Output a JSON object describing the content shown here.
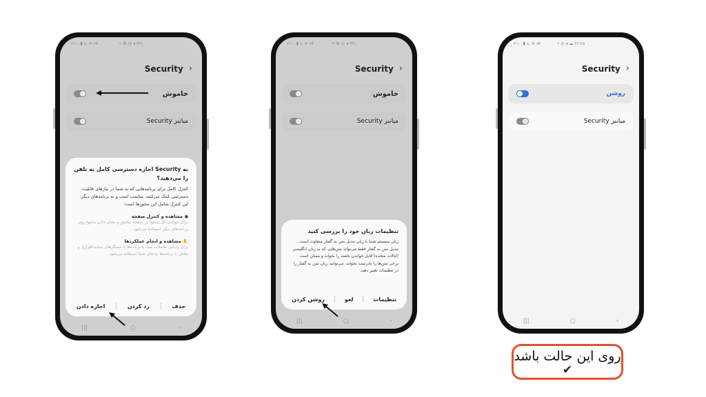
{
  "phones": [
    {
      "header_title": "Security",
      "status_left": "۲۱:۰ ▮ ⊾ ≋ ⋊",
      "status_right": "• ⌘ ◎ ◂ ٩٩٪",
      "rows": [
        {
          "label": "خاموش",
          "toggle": "off"
        },
        {
          "label": "میانبر Security",
          "toggle": "off"
        }
      ],
      "dialog": {
        "title": "به Security اجازه دسترسی کامل به تلفن را می‌دهید؟",
        "body": "کنترل کامل برای برنامه‌هایی که به شما در نیازهای قابلیت دسترسی کمک می‌کنند، مناسب است و نه برنامه‌های دیگر. این کنترل شامل این مجوزها است:",
        "perm1_title": "مشاهده و کنترل صفحه",
        "perm1_desc": "برای خواندن کل محتوا در صفحه نمایش و نشان دادن محتوا روی برنامه‌های دیگر استفاده می‌شود",
        "perm2_title": "مشاهده و انجام عملکردها",
        "perm2_desc": "برای ردیابی تعاملات شما با برنامه‌ها یا حسگرهای سخت‌افزاری و تعامل با برنامه‌ها به جای شما استفاده می‌شود",
        "actions": [
          "حذف",
          "رد کردن",
          "اجازه دادن"
        ]
      }
    },
    {
      "header_title": "Security",
      "status_left": "۲۱:۰ ▮ ⊾ ≋ ⋊",
      "status_right": "• ⌘ ◎ ◂ ٩٩٪",
      "rows": [
        {
          "label": "خاموش",
          "toggle": "off"
        },
        {
          "label": "میانبر Security",
          "toggle": "off"
        }
      ],
      "dialog": {
        "title": "تنظیمات زبان خود را بررسی کنید",
        "body": "زبان سیستم شما با زبان تبدیل متن به گفتار متفاوت است. تبدیل متن به گفتار فقط می‌تواند متن‌هایی که به زبان انگلیسی (ایالات متحده) قابل خواندن باشند را بخواند و ممکن است برخی متن‌ها را نادرست بخواند. می‌توانید زبان متن به گفتار را در تنظیمات تغییر دهید.",
        "actions": [
          "تنظیمات",
          "لغو",
          "روشن کردن"
        ]
      }
    },
    {
      "header_title": "Security",
      "status_left": "۲۱:۰ ▮ ⊾ ≋ ⋊",
      "status_right": "• ◎ ◂ ☁ ۲۲:۲۵",
      "rows": [
        {
          "label": "روشن",
          "toggle": "on"
        },
        {
          "label": "میانبر Security",
          "toggle": "off"
        }
      ]
    }
  ],
  "navbar": {
    "recent": "|||",
    "home": "○",
    "back": "›"
  },
  "chevron": "›",
  "note": {
    "text": "روی این حالت باشد",
    "check": "✔"
  },
  "colors": {
    "accent": "#2f72d8",
    "note_border": "#e2502f"
  }
}
